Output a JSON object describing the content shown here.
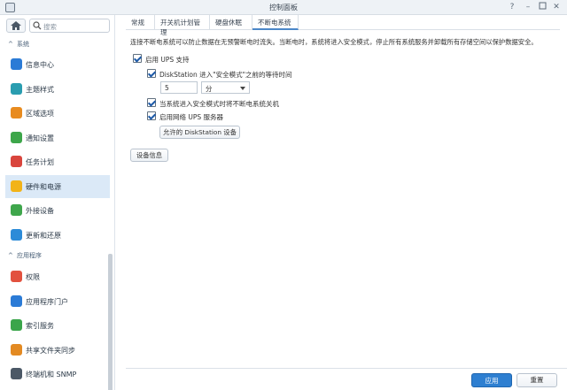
{
  "window": {
    "title": "控制面板"
  },
  "sidebar": {
    "search_placeholder": "搜索",
    "section_system": "系统",
    "section_apps": "应用程序",
    "system_items": [
      {
        "label": "信息中心",
        "icon": "info-icon",
        "color": "#2b7bd6"
      },
      {
        "label": "主题样式",
        "icon": "palette-icon",
        "color": "#2a9db0"
      },
      {
        "label": "区域选项",
        "icon": "clock-calendar-icon",
        "color": "#e88b1f"
      },
      {
        "label": "通知设置",
        "icon": "chat-icon",
        "color": "#3da64a"
      },
      {
        "label": "任务计划",
        "icon": "calendar-check-icon",
        "color": "#d9453d"
      },
      {
        "label": "硬件和电源",
        "icon": "bulb-icon",
        "color": "#f2b318",
        "active": true
      },
      {
        "label": "外接设备",
        "icon": "upload-icon",
        "color": "#3fa64c"
      },
      {
        "label": "更新和还原",
        "icon": "refresh-icon",
        "color": "#2c8bd8"
      }
    ],
    "app_items": [
      {
        "label": "权限",
        "icon": "grid-icon",
        "color": "#e2513e"
      },
      {
        "label": "应用程序门户",
        "icon": "arrow-box-icon",
        "color": "#2b7bd6"
      },
      {
        "label": "索引服务",
        "icon": "magnify-icon",
        "color": "#3aa54a"
      },
      {
        "label": "共享文件夹同步",
        "icon": "sync-icon",
        "color": "#e38a22"
      },
      {
        "label": "终端机和 SNMP",
        "icon": "terminal-icon",
        "color": "#4b5866"
      }
    ]
  },
  "tabs": [
    {
      "label": "常规",
      "active": false
    },
    {
      "label": "开关机计划管理",
      "active": false
    },
    {
      "label": "硬盘休眠",
      "active": false
    },
    {
      "label": "不断电系统",
      "active": true
    }
  ],
  "ups": {
    "description": "连接不断电系统可以防止数据在无预警断电时流失。当断电时，系统将进入安全模式，停止所有系统服务并卸载所有存储空间以保护数据安全。",
    "enable_ups_label": "启用 UPS 支持",
    "safe_mode_wait_label": "DiskStation 进入\"安全模式\"之前的等待时间",
    "wait_value": "5",
    "wait_unit": "分",
    "shutdown_label": "当系统进入安全模式时将不断电系统关机",
    "network_server_label": "启用网络 UPS 服务器",
    "permitted_button": "允许的 DiskStation 设备",
    "device_info_button": "设备信息"
  },
  "footer": {
    "apply": "应用",
    "reset": "重置"
  }
}
